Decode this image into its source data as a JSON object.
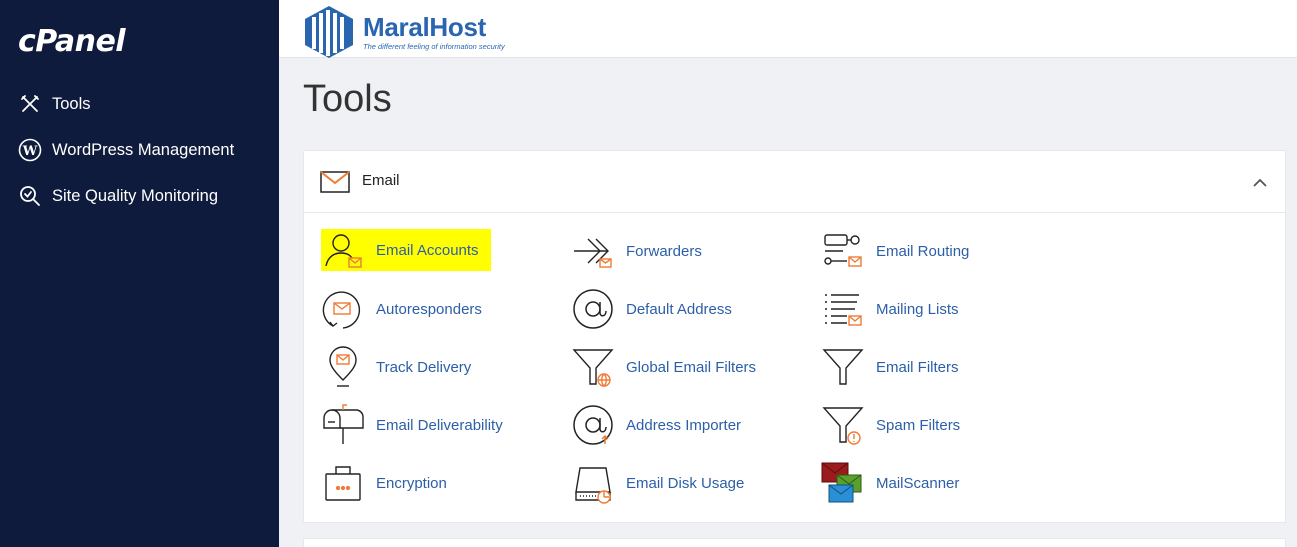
{
  "sidebar": {
    "brand": "cPanel",
    "items": [
      {
        "label": "Tools",
        "icon": "tools-icon"
      },
      {
        "label": "WordPress Management",
        "icon": "wordpress-icon"
      },
      {
        "label": "Site Quality Monitoring",
        "icon": "site-quality-icon"
      }
    ]
  },
  "header": {
    "logo_name": "MaralHost",
    "logo_tagline": "The different feeling of information security"
  },
  "page": {
    "title": "Tools"
  },
  "email_section": {
    "title": "Email",
    "icon": "envelope-icon",
    "tools": [
      {
        "label": "Email Accounts",
        "icon": "email-accounts-icon",
        "highlighted": true
      },
      {
        "label": "Forwarders",
        "icon": "forwarders-icon"
      },
      {
        "label": "Email Routing",
        "icon": "email-routing-icon"
      },
      {
        "label": "Autoresponders",
        "icon": "autoresponders-icon"
      },
      {
        "label": "Default Address",
        "icon": "default-address-icon"
      },
      {
        "label": "Mailing Lists",
        "icon": "mailing-lists-icon"
      },
      {
        "label": "Track Delivery",
        "icon": "track-delivery-icon"
      },
      {
        "label": "Global Email Filters",
        "icon": "global-email-filters-icon"
      },
      {
        "label": "Email Filters",
        "icon": "email-filters-icon"
      },
      {
        "label": "Email Deliverability",
        "icon": "email-deliverability-icon"
      },
      {
        "label": "Address Importer",
        "icon": "address-importer-icon"
      },
      {
        "label": "Spam Filters",
        "icon": "spam-filters-icon"
      },
      {
        "label": "Encryption",
        "icon": "encryption-icon"
      },
      {
        "label": "Email Disk Usage",
        "icon": "email-disk-usage-icon"
      },
      {
        "label": "MailScanner",
        "icon": "mailscanner-icon"
      }
    ]
  },
  "colors": {
    "sidebar_bg": "#0f1b3c",
    "link": "#2c5fa8",
    "accent_orange": "#f07b35",
    "highlight": "#ffff00"
  }
}
